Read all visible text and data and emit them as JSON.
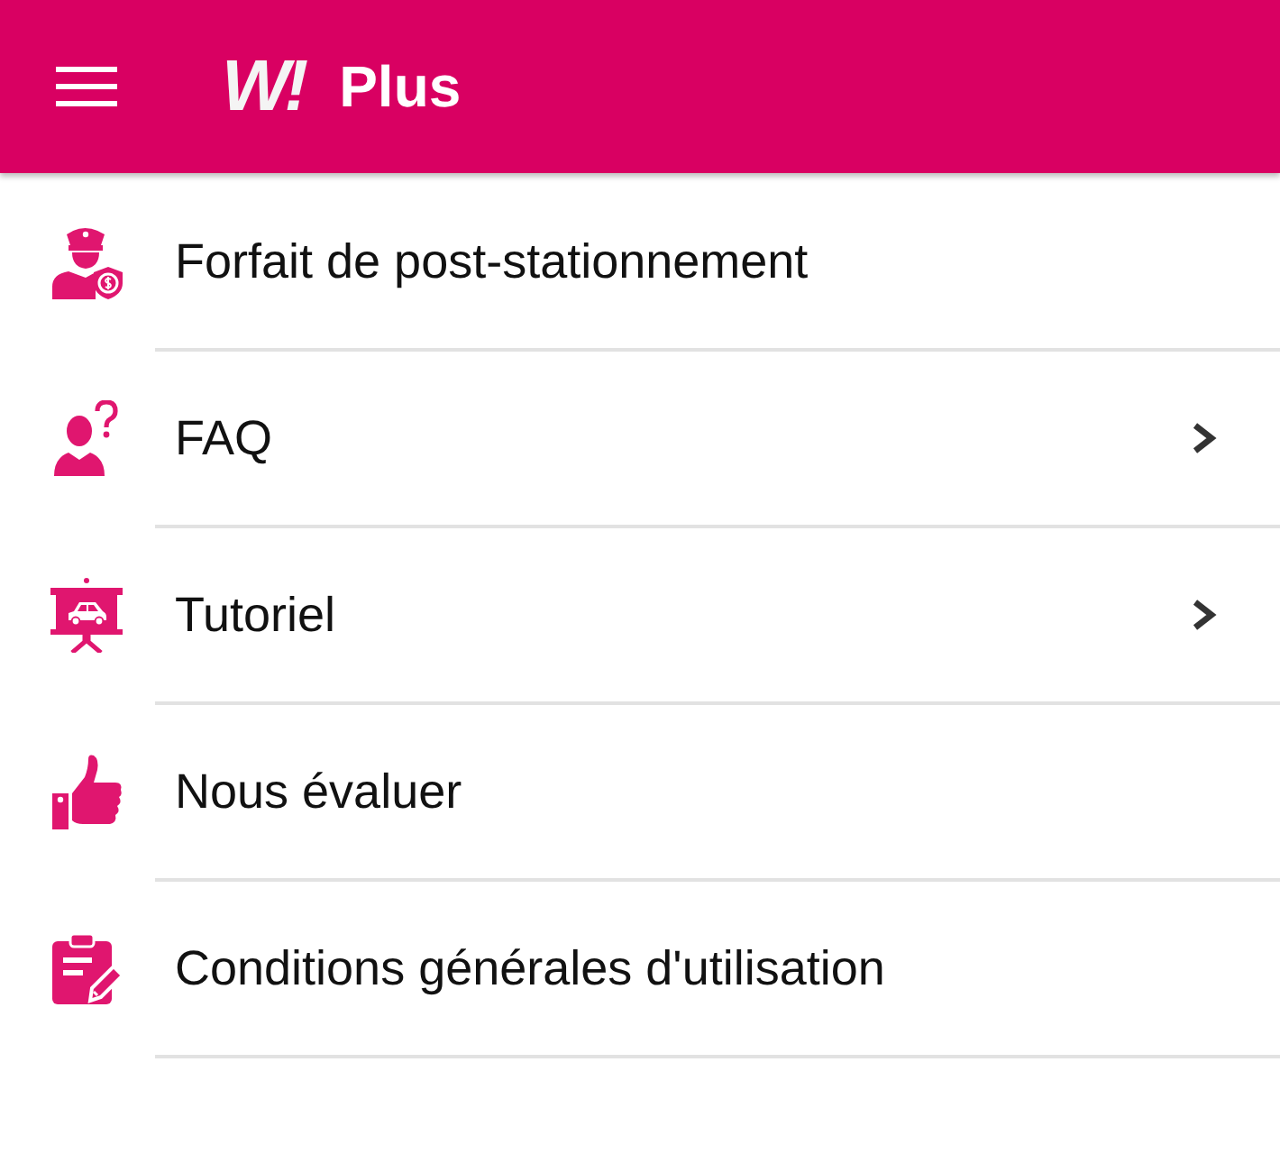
{
  "header": {
    "logo": "W!",
    "title": "Plus"
  },
  "items": [
    {
      "label": "Forfait de post-stationnement",
      "submenu": false
    },
    {
      "label": "FAQ",
      "submenu": true
    },
    {
      "label": "Tutoriel",
      "submenu": true
    },
    {
      "label": "Nous évaluer",
      "submenu": false
    },
    {
      "label": "Conditions générales d'utilisation",
      "submenu": false
    }
  ]
}
